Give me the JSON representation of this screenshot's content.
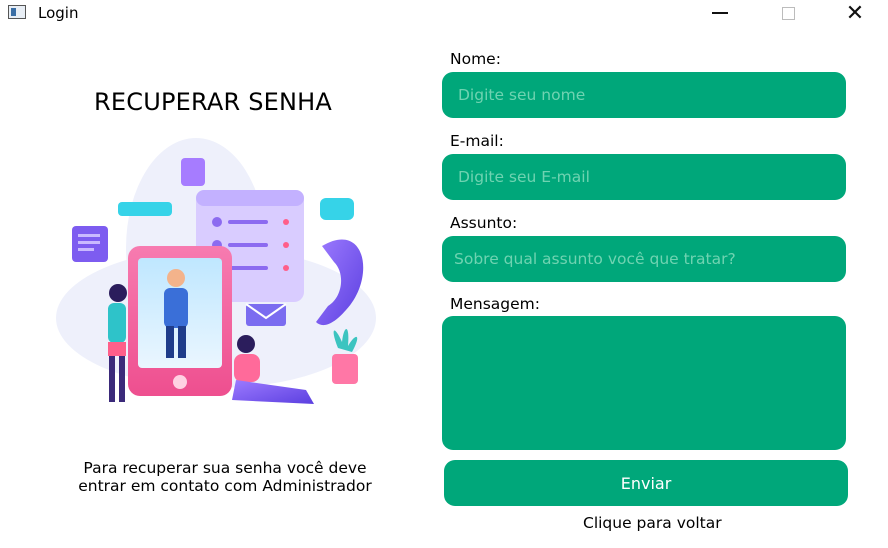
{
  "window": {
    "title": "Login"
  },
  "left": {
    "heading": "RECUPERAR SENHA",
    "info_line1": "Para recuperar sua senha você deve",
    "info_line2": "entrar em contato com Administrador"
  },
  "form": {
    "name": {
      "label": "Nome:",
      "placeholder": "Digite seu nome"
    },
    "email": {
      "label": "E-mail:",
      "placeholder": "Digite seu E-mail"
    },
    "subject": {
      "label": "Assunto:",
      "placeholder": "Sobre qual assunto você que tratar?"
    },
    "message": {
      "label": "Mensagem:",
      "placeholder": ""
    },
    "submit_label": "Enviar",
    "back_link": "Clique para voltar"
  },
  "colors": {
    "accent": "#00a77a",
    "placeholder": "#6fd3b1"
  }
}
